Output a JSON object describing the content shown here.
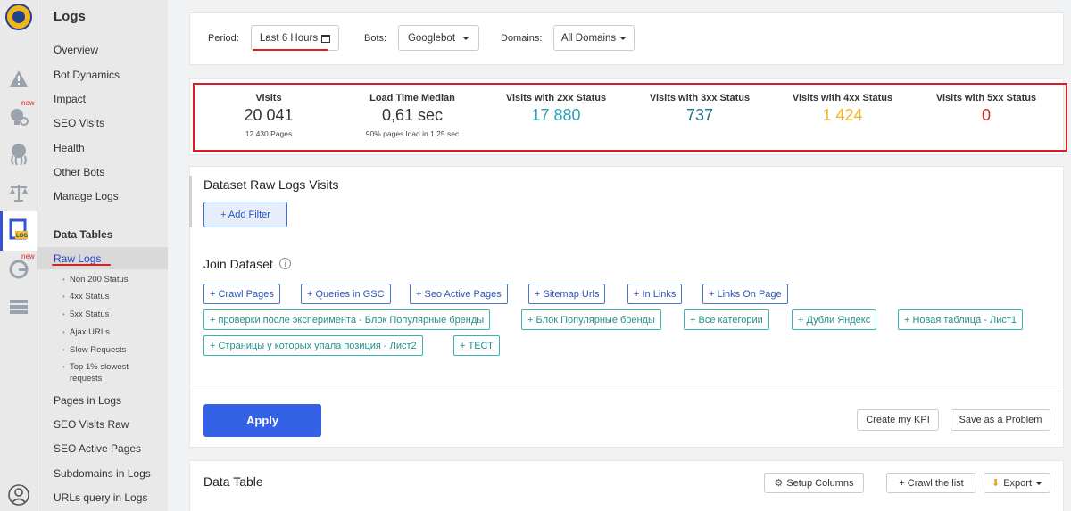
{
  "rail": {
    "logs_badge": "LOG",
    "new_badge": "new"
  },
  "sidebar": {
    "title": "Logs",
    "items": [
      "Overview",
      "Bot Dynamics",
      "Impact",
      "SEO Visits",
      "Health",
      "Other Bots",
      "Manage Logs"
    ],
    "data_tables_heading": "Data Tables",
    "active_item": "Raw Logs",
    "sub_items": [
      "Non 200 Status",
      "4xx Status",
      "5xx Status",
      "Ajax URLs",
      "Slow Requests",
      "Top 1% slowest requests"
    ],
    "more_items": [
      "Pages in Logs",
      "SEO Visits Raw",
      "SEO Active Pages",
      "Subdomains in Logs",
      "URLs query in Logs"
    ]
  },
  "filters": {
    "period_label": "Period:",
    "period_value": "Last 6 Hours",
    "bots_label": "Bots:",
    "bots_value": "Googlebot",
    "domains_label": "Domains:",
    "domains_value": "All Domains"
  },
  "kpis": [
    {
      "title": "Visits",
      "value": "20 041",
      "sub": "12 430 Pages",
      "color": "#333333"
    },
    {
      "title": "Load Time Median",
      "value": "0,61 sec",
      "sub": "90% pages load in 1,25 sec",
      "color": "#333333"
    },
    {
      "title": "Visits with 2xx Status",
      "value": "17 880",
      "sub": "",
      "color": "#2ba3b5"
    },
    {
      "title": "Visits with 3xx Status",
      "value": "737",
      "sub": "",
      "color": "#1e6f8c"
    },
    {
      "title": "Visits with 4xx Status",
      "value": "1 424",
      "sub": "",
      "color": "#f0b429"
    },
    {
      "title": "Visits with 5xx Status",
      "value": "0",
      "sub": "",
      "color": "#d9232d"
    }
  ],
  "dataset": {
    "title": "Dataset Raw Logs Visits",
    "add_filter": "+ Add Filter",
    "join_title": "Join Dataset",
    "join_tags_blue": [
      "+ Crawl Pages",
      "+ Queries in GSC",
      "+ Seo Active Pages",
      "+ Sitemap Urls",
      "+ In Links",
      "+ Links On Page"
    ],
    "join_tags_teal": [
      "+ проверки после эксперимента - Блок Популярные бренды",
      "+ Блок Популярные бренды",
      "+ Все категории",
      "+ Дубли Яндекс",
      "+ Новая таблица - Лист1",
      "+ Страницы у которых упала позиция - Лист2",
      "+ ТЕСТ"
    ],
    "apply": "Apply",
    "create_kpi": "Create my KPI",
    "save_problem": "Save as a Problem"
  },
  "data_table": {
    "title": "Data Table",
    "setup_columns": "Setup Columns",
    "crawl_list": "+ Crawl the list",
    "export": "Export"
  }
}
